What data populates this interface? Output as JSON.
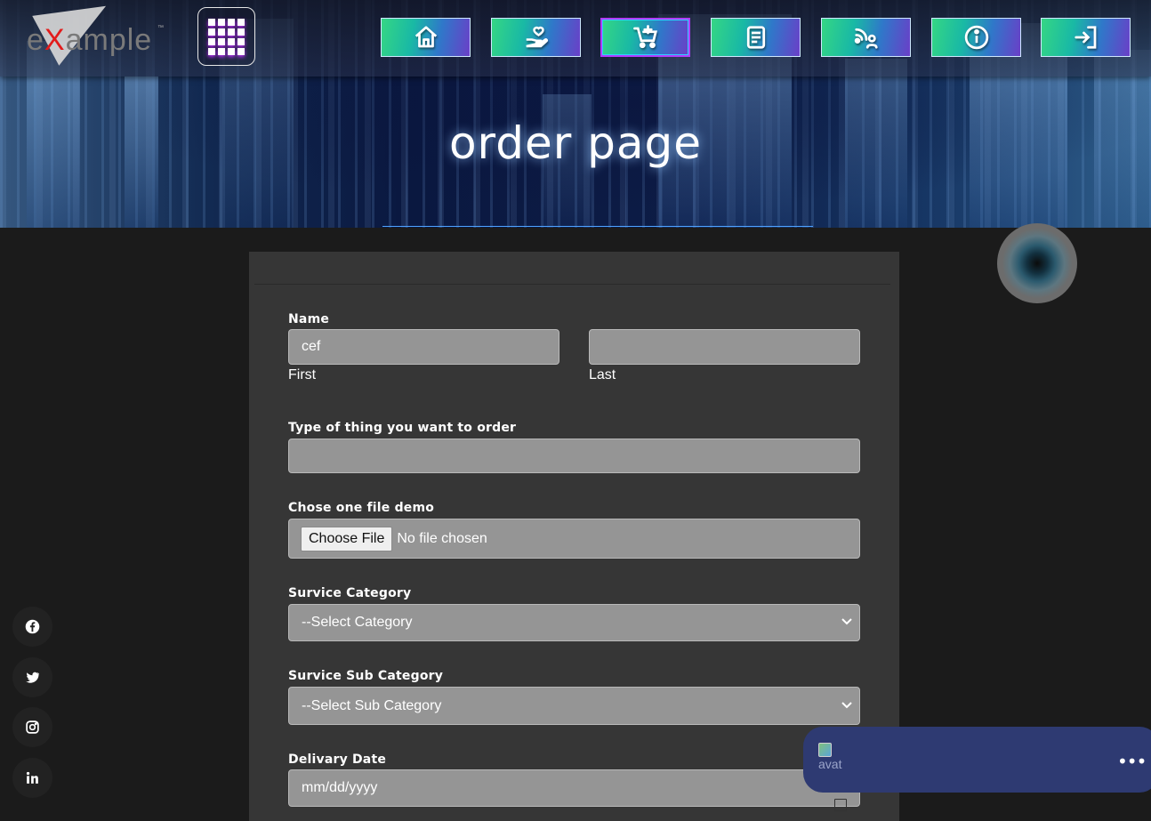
{
  "header": {
    "logo": {
      "prefix": "e",
      "accent": "X",
      "suffix": "ample",
      "tm": "™"
    },
    "nav": [
      {
        "name": "home",
        "icon": "home-icon"
      },
      {
        "name": "donate",
        "icon": "hand-heart-icon"
      },
      {
        "name": "order",
        "icon": "cart-add-icon",
        "active": true
      },
      {
        "name": "document",
        "icon": "document-icon"
      },
      {
        "name": "feed",
        "icon": "signal-person-icon"
      },
      {
        "name": "info",
        "icon": "info-icon"
      },
      {
        "name": "login",
        "icon": "login-icon"
      }
    ],
    "title": "order page"
  },
  "form": {
    "name_label": "Name",
    "first_value": "cef",
    "first_sub": "First",
    "last_value": "",
    "last_sub": "Last",
    "type_label": "Type of thing you want to order",
    "type_value": "",
    "file_label": "Chose one file demo",
    "file_button": "Choose File",
    "file_status": "No file chosen",
    "category_label": "Survice Category",
    "category_value": "--Select Category",
    "subcategory_label": "Survice Sub Category",
    "subcategory_value": "--Select Sub Category",
    "date_label": "Delivary Date",
    "date_placeholder": "mm/dd/yyyy"
  },
  "social": [
    "facebook",
    "twitter",
    "instagram",
    "linkedin"
  ],
  "chat": {
    "avatar_alt": "avat",
    "menu": "•••"
  },
  "colors": {
    "page_bg": "#1b1b1b",
    "card_bg": "#363636",
    "field_bg": "#959595",
    "chat_bg": "#2e3a72",
    "logo_accent": "#e21b1b"
  }
}
